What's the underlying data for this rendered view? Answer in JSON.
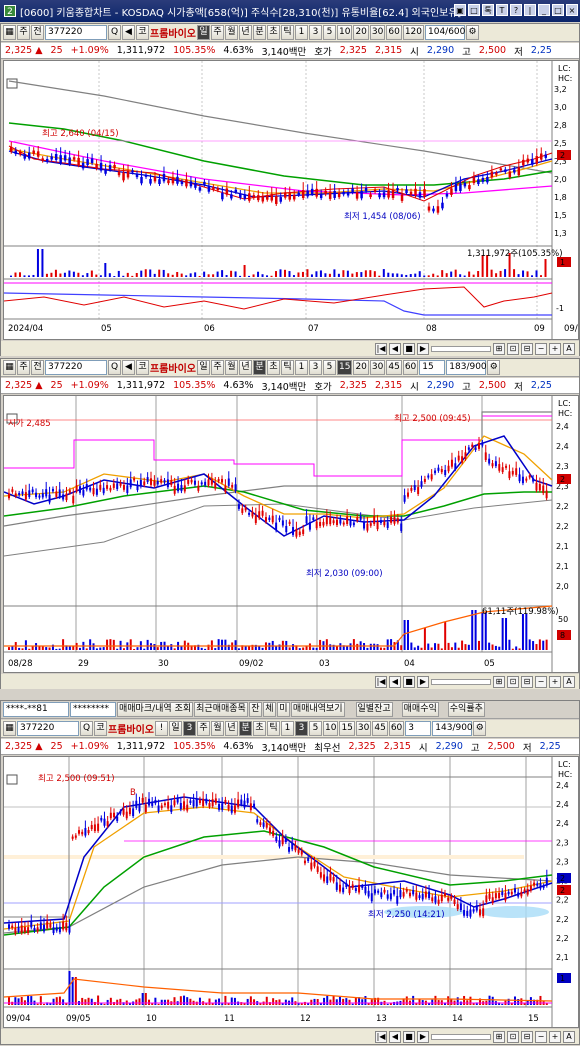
{
  "window": {
    "title": "[0600] 키움종합차트 - KOSDAQ 시가총액[658(억)] 주식수[28,310(천)] 유통비율[62.4] 외국인보유[",
    "badge": "2",
    "controls": [
      "▣",
      "□",
      "톡",
      "T",
      "?",
      "|",
      "_",
      "□",
      "×"
    ]
  },
  "panels": [
    {
      "id": "daily",
      "toolbar": {
        "items": [
          "주",
          "전"
        ],
        "code": "377220",
        "type": "코",
        "name": "프롬바이오",
        "periods": [
          "일",
          "주",
          "월",
          "년",
          "분",
          "초",
          "틱"
        ],
        "active_period": "일",
        "intervals": [
          "1",
          "3",
          "5",
          "10",
          "20",
          "30",
          "60",
          "120"
        ],
        "count": "104/600"
      },
      "quote": {
        "price": "2,325 ▲",
        "change": "25",
        "pct": "+1.09%",
        "volume": "1,311,972",
        "vol_ratio": "105.35%",
        "turnover": "4.63%",
        "amount": "3,140백만",
        "bid_label": "호가",
        "bid1": "2,325",
        "bid2": "2,315",
        "open_label": "시",
        "open": "2,290",
        "high_label": "고",
        "high": "2,500",
        "low_label": "저",
        "low": "2,25"
      },
      "annotations": {
        "high": "최고 2,640 (04/15)",
        "low": "최저 1,454 (08/06)",
        "volume": "1,311,972주(105.35%)"
      },
      "yaxis": [
        "3,2",
        "3,0",
        "2,8",
        "2,5",
        "2,3",
        "2,0",
        "1,8",
        "1,5",
        "1,3"
      ],
      "xaxis": [
        "2024/04",
        "05",
        "06",
        "07",
        "08",
        "09",
        "09/"
      ],
      "badges": [
        "LC:",
        "HC:",
        "2",
        "1",
        "-1"
      ]
    },
    {
      "id": "minute15",
      "toolbar": {
        "items": [
          "주",
          "전"
        ],
        "code": "377220",
        "type": "코",
        "name": "프롬바이오",
        "periods": [
          "일",
          "주",
          "월",
          "년",
          "분",
          "초",
          "틱"
        ],
        "active_period": "분",
        "intervals": [
          "1",
          "3",
          "5",
          "15",
          "20",
          "30",
          "45",
          "60"
        ],
        "active_interval": "15",
        "sel": "15",
        "count": "183/900"
      },
      "quote": {
        "price": "2,325 ▲",
        "change": "25",
        "pct": "+1.09%",
        "volume": "1,311,972",
        "vol_ratio": "105.35%",
        "turnover": "4.63%",
        "amount": "3,140백만",
        "bid_label": "호가",
        "bid1": "2,325",
        "bid2": "2,315",
        "open_label": "시",
        "open": "2,290",
        "high_label": "고",
        "high": "2,500",
        "low_label": "저",
        "low": "2,25"
      },
      "annotations": {
        "high": "최고 2,500 (09:45)",
        "low": "최저 2,030 (09:00)",
        "open": "시가 2,485",
        "volume": "61,11주(119.98%)"
      },
      "yaxis": [
        "2,4",
        "2,4",
        "2,3",
        "2,3",
        "2,2",
        "2,2",
        "2,1",
        "2,1",
        "2,0"
      ],
      "xaxis": [
        "08/28",
        "29",
        "30",
        "09/02",
        "03",
        "04",
        "05"
      ],
      "badges": [
        "LC:",
        "HC:",
        "2",
        "50",
        "8"
      ]
    },
    {
      "id": "minute3",
      "topbar": {
        "account": "****-**81",
        "password": "********",
        "buttons": [
          "매매마크/내역 조회",
          "최근매매종목",
          "잔",
          "체",
          "미",
          "매매내역보기",
          "일별잔고",
          "매매수익",
          "수익률추"
        ]
      },
      "toolbar": {
        "items": [
          "전"
        ],
        "code": "377220",
        "type": "코",
        "name": "프롬바이오",
        "excl": "!",
        "periods": [
          "일",
          "3",
          "주",
          "월",
          "년",
          "분",
          "초",
          "틱"
        ],
        "active_period": "분",
        "intervals": [
          "1",
          "3",
          "5",
          "10",
          "15",
          "30",
          "45",
          "60"
        ],
        "active_interval": "3",
        "sel": "3",
        "count": "143/900"
      },
      "quote": {
        "price": "2,325 ▲",
        "change": "25",
        "pct": "+1.09%",
        "volume": "1,311,972",
        "vol_ratio": "105.35%",
        "turnover": "4.63%",
        "amount": "3,140백만",
        "bid_label": "최우선",
        "bid1": "2,325",
        "bid2": "2,315",
        "open_label": "시",
        "open": "2,290",
        "high_label": "고",
        "high": "2,500",
        "low_label": "저",
        "low": "2,25"
      },
      "annotations": {
        "high": "최고 2,500 (09:51)",
        "low": "최저 2,250 (14:21)",
        "marker": "B"
      },
      "yaxis": [
        "2,4",
        "2,4",
        "2,4",
        "2,3",
        "2,3",
        "2,3",
        "2,2",
        "2,2",
        "2,2",
        "2,1"
      ],
      "xaxis": [
        "09/04",
        "09/05",
        "10",
        "11",
        "12",
        "13",
        "14",
        "15"
      ],
      "badges": [
        "LC:",
        "HC:",
        "2",
        "2",
        "1"
      ]
    }
  ],
  "colors": {
    "up": "#e00000",
    "down": "#0000e0",
    "ma5": "#e00000",
    "ma10": "#0000c8",
    "ma20": "#f0a000",
    "ma60": "#00a000",
    "ma120": "#808080",
    "ma240": "#ff00ff"
  }
}
